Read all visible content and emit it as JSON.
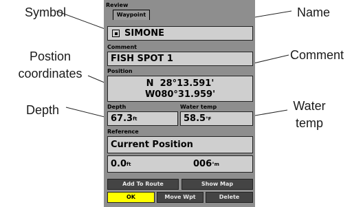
{
  "callouts": {
    "symbol": "Symbol",
    "name": "Name",
    "position_line1": "Postion",
    "position_line2": "coordinates",
    "comment": "Comment",
    "depth": "Depth",
    "water_temp_line1": "Water",
    "water_temp_line2": "temp"
  },
  "screen": {
    "title": "Review",
    "tab": "Waypoint",
    "symbol_icon": "square-waypoint-icon",
    "name": "SIMONE",
    "comment_label": "Comment",
    "comment": "FISH SPOT 1",
    "position_label": "Position",
    "position_lat": "N  28°13.591'",
    "position_lon": "W080°31.959'",
    "depth_label": "Depth",
    "depth_value": "67.3",
    "depth_unit": "ft",
    "water_temp_label": "Water temp",
    "water_temp_value": "58.5",
    "water_temp_unit": "°F",
    "reference_label": "Reference",
    "reference_value": "Current Position",
    "distance_value": "0.0",
    "distance_unit": "ft",
    "bearing_value": "006",
    "bearing_unit": "°m"
  },
  "buttons": {
    "add_to_route": "Add To Route",
    "show_map": "Show Map",
    "ok": "OK",
    "move_wpt": "Move Wpt",
    "delete": "Delete"
  },
  "colors": {
    "screen_bg": "#8e8e8e",
    "field_bg": "#cfcfcf",
    "button_bg": "#444444",
    "ok_highlight": "#ffff00"
  }
}
